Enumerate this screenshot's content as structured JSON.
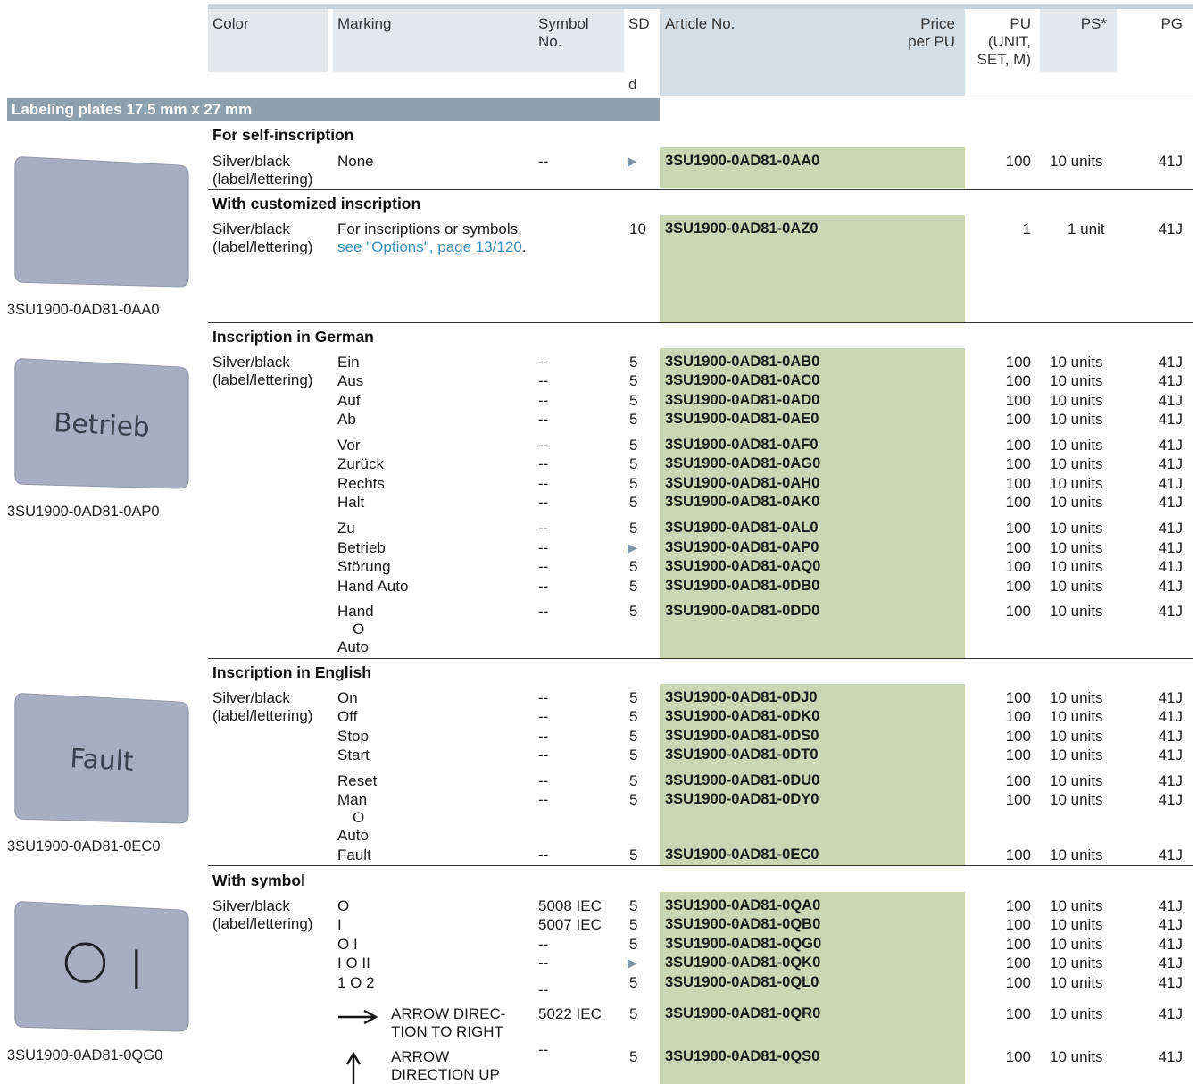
{
  "header": {
    "color": "Color",
    "marking": "Marking",
    "symbol_l1": "Symbol",
    "symbol_l2": "No.",
    "sd": "SD",
    "sd_unit": "d",
    "article": "Article No.",
    "price_l1": "Price",
    "price_l2": "per PU",
    "pu_l1": "PU",
    "pu_l2": "(UNIT,",
    "pu_l3": "SET, M)",
    "ps": "PS*",
    "pg": "PG"
  },
  "category_title": "Labeling plates 17.5 mm x 27 mm",
  "color_text": {
    "l1": "Silver/black",
    "l2": "(label/lettering)"
  },
  "images": [
    {
      "caption": "3SU1900-0AD81-0AA0",
      "plate_text": ""
    },
    {
      "caption": "3SU1900-0AD81-0AP0",
      "plate_text": "Betrieb"
    },
    {
      "caption": "3SU1900-0AD81-0EC0",
      "plate_text": "Fault"
    },
    {
      "caption": "3SU1900-0AD81-0QG0",
      "plate_text": "O |"
    }
  ],
  "sections": {
    "self": {
      "title": "For self-inscription",
      "row": {
        "marking": "None",
        "symbol": "--",
        "sd": "▶",
        "article": "3SU1900-0AD81-0AA0",
        "pu": "100",
        "ps": "10 units",
        "pg": "41J"
      }
    },
    "custom": {
      "title": "With customized inscription",
      "row": {
        "marking_l1": "For inscriptions or symbols,",
        "marking_link": "see \"Options\", page 13/120",
        "marking_end": ".",
        "sd": "10",
        "article": "3SU1900-0AD81-0AZ0",
        "pu": "1",
        "ps": "1 unit",
        "pg": "41J"
      }
    },
    "german": {
      "title": "Inscription in German",
      "rows": [
        {
          "marking": "Ein",
          "symbol": "--",
          "sd": "5",
          "article": "3SU1900-0AD81-0AB0",
          "pu": "100",
          "ps": "10 units",
          "pg": "41J"
        },
        {
          "marking": "Aus",
          "symbol": "--",
          "sd": "5",
          "article": "3SU1900-0AD81-0AC0",
          "pu": "100",
          "ps": "10 units",
          "pg": "41J"
        },
        {
          "marking": "Auf",
          "symbol": "--",
          "sd": "5",
          "article": "3SU1900-0AD81-0AD0",
          "pu": "100",
          "ps": "10 units",
          "pg": "41J"
        },
        {
          "marking": "Ab",
          "symbol": "--",
          "sd": "5",
          "article": "3SU1900-0AD81-0AE0",
          "pu": "100",
          "ps": "10 units",
          "pg": "41J"
        },
        {
          "marking": "Vor",
          "symbol": "--",
          "sd": "5",
          "article": "3SU1900-0AD81-0AF0",
          "pu": "100",
          "ps": "10 units",
          "pg": "41J"
        },
        {
          "marking": "Zurück",
          "symbol": "--",
          "sd": "5",
          "article": "3SU1900-0AD81-0AG0",
          "pu": "100",
          "ps": "10 units",
          "pg": "41J"
        },
        {
          "marking": "Rechts",
          "symbol": "--",
          "sd": "5",
          "article": "3SU1900-0AD81-0AH0",
          "pu": "100",
          "ps": "10 units",
          "pg": "41J"
        },
        {
          "marking": "Halt",
          "symbol": "--",
          "sd": "5",
          "article": "3SU1900-0AD81-0AK0",
          "pu": "100",
          "ps": "10 units",
          "pg": "41J"
        },
        {
          "marking": "Zu",
          "symbol": "--",
          "sd": "5",
          "article": "3SU1900-0AD81-0AL0",
          "pu": "100",
          "ps": "10 units",
          "pg": "41J"
        },
        {
          "marking": "Betrieb",
          "symbol": "--",
          "sd": "▶",
          "article": "3SU1900-0AD81-0AP0",
          "pu": "100",
          "ps": "10 units",
          "pg": "41J"
        },
        {
          "marking": "Störung",
          "symbol": "--",
          "sd": "5",
          "article": "3SU1900-0AD81-0AQ0",
          "pu": "100",
          "ps": "10 units",
          "pg": "41J"
        },
        {
          "marking": "Hand Auto",
          "symbol": "--",
          "sd": "5",
          "article": "3SU1900-0AD81-0DB0",
          "pu": "100",
          "ps": "10 units",
          "pg": "41J"
        },
        {
          "marking": "Hand",
          "marking_l2": "O",
          "marking_l3": "Auto",
          "symbol": "--",
          "sd": "5",
          "article": "3SU1900-0AD81-0DD0",
          "pu": "100",
          "ps": "10 units",
          "pg": "41J"
        }
      ]
    },
    "english": {
      "title": "Inscription in English",
      "rows": [
        {
          "marking": "On",
          "symbol": "--",
          "sd": "5",
          "article": "3SU1900-0AD81-0DJ0",
          "pu": "100",
          "ps": "10 units",
          "pg": "41J"
        },
        {
          "marking": "Off",
          "symbol": "--",
          "sd": "5",
          "article": "3SU1900-0AD81-0DK0",
          "pu": "100",
          "ps": "10 units",
          "pg": "41J"
        },
        {
          "marking": "Stop",
          "symbol": "--",
          "sd": "5",
          "article": "3SU1900-0AD81-0DS0",
          "pu": "100",
          "ps": "10 units",
          "pg": "41J"
        },
        {
          "marking": "Start",
          "symbol": "--",
          "sd": "5",
          "article": "3SU1900-0AD81-0DT0",
          "pu": "100",
          "ps": "10 units",
          "pg": "41J"
        },
        {
          "marking": "Reset",
          "symbol": "--",
          "sd": "5",
          "article": "3SU1900-0AD81-0DU0",
          "pu": "100",
          "ps": "10 units",
          "pg": "41J"
        },
        {
          "marking": "Man",
          "marking_l2": "O",
          "marking_l3": "Auto",
          "symbol": "--",
          "sd": "5",
          "article": "3SU1900-0AD81-0DY0",
          "pu": "100",
          "ps": "10 units",
          "pg": "41J"
        },
        {
          "marking": "Fault",
          "symbol": "--",
          "sd": "5",
          "article": "3SU1900-0AD81-0EC0",
          "pu": "100",
          "ps": "10 units",
          "pg": "41J"
        }
      ]
    },
    "symbol": {
      "title": "With symbol",
      "rows": [
        {
          "marking": "O",
          "symbol": "5008 IEC",
          "sd": "5",
          "article": "3SU1900-0AD81-0QA0",
          "pu": "100",
          "ps": "10 units",
          "pg": "41J"
        },
        {
          "marking": "I",
          "symbol": "5007 IEC",
          "sd": "5",
          "article": "3SU1900-0AD81-0QB0",
          "pu": "100",
          "ps": "10 units",
          "pg": "41J"
        },
        {
          "marking": "O I",
          "symbol": "--",
          "sd": "5",
          "article": "3SU1900-0AD81-0QG0",
          "pu": "100",
          "ps": "10 units",
          "pg": "41J"
        },
        {
          "marking": "I O II",
          "symbol": "--",
          "sd": "▶",
          "article": "3SU1900-0AD81-0QK0",
          "pu": "100",
          "ps": "10 units",
          "pg": "41J"
        },
        {
          "marking": "1 O 2",
          "symbol": "--",
          "sd": "5",
          "article": "3SU1900-0AD81-0QL0",
          "pu": "100",
          "ps": "10 units",
          "pg": "41J"
        },
        {
          "marking": "ARROW DIREC-",
          "marking_l2": "TION TO RIGHT",
          "symbol": "5022 IEC",
          "sd": "5",
          "article": "3SU1900-0AD81-0QR0",
          "pu": "100",
          "ps": "10 units",
          "pg": "41J",
          "icon": "arrow-right-icon"
        },
        {
          "marking": "ARROW",
          "marking_l2": "DIRECTION UP",
          "symbol": "--",
          "sd": "5",
          "article": "3SU1900-0AD81-0QS0",
          "pu": "100",
          "ps": "10 units",
          "pg": "41J",
          "icon": "arrow-up-icon"
        }
      ]
    }
  },
  "colors": {
    "header_bg": "#e3e8ec",
    "article_header_bg": "#d3dee6",
    "green": "#cbd6b4",
    "category_bg": "#8da0ae",
    "link": "#3a8fb7",
    "plate": "#a7aec1"
  }
}
